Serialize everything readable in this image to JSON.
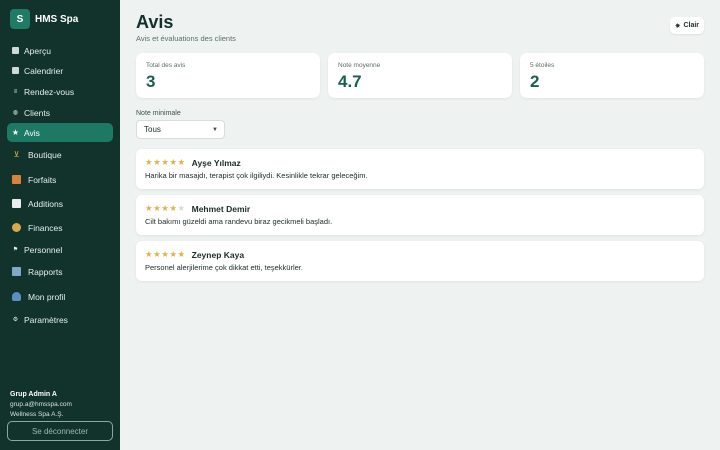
{
  "brand": {
    "logo_letter": "S",
    "name": "HMS Spa"
  },
  "nav": [
    {
      "label": "Aperçu",
      "icon": "overview-icon"
    },
    {
      "label": "Calendrier",
      "icon": "calendar-icon"
    },
    {
      "label": "Rendez-vous",
      "icon": "appointments-icon"
    },
    {
      "label": "Clients",
      "icon": "clients-icon"
    },
    {
      "label": "Avis",
      "icon": "star-icon"
    },
    {
      "label": "Boutique",
      "icon": "cart-icon"
    },
    {
      "label": "Forfaits",
      "icon": "package-icon"
    },
    {
      "label": "Additions",
      "icon": "receipt-icon"
    },
    {
      "label": "Finances",
      "icon": "money-bag-icon"
    },
    {
      "label": "Personnel",
      "icon": "flag-icon"
    },
    {
      "label": "Rapports",
      "icon": "chart-icon"
    },
    {
      "label": "Mon profil",
      "icon": "user-icon"
    },
    {
      "label": "Paramètres",
      "icon": "gear-icon"
    }
  ],
  "active_nav": "Avis",
  "user": {
    "name": "Grup Admin A",
    "email": "grup.a@hmsspa.com",
    "company": "Wellness Spa A.Ş."
  },
  "logout_label": "Se déconnecter",
  "header": {
    "title": "Avis",
    "subtitle": "Avis et évaluations des clients",
    "theme_label": "Clair",
    "theme_icon": "sun-icon"
  },
  "stats": [
    {
      "label": "Total des avis",
      "value": "3"
    },
    {
      "label": "Note moyenne",
      "value": "4.7"
    },
    {
      "label": "5 étoiles",
      "value": "2"
    }
  ],
  "filter": {
    "label": "Note minimale",
    "selected": "Tous"
  },
  "reviews": [
    {
      "author": "Ayşe Yılmaz",
      "rating": 5,
      "text": "Harika bir masajdı, terapist çok ilgiliydi. Kesinlikle tekrar geleceğim."
    },
    {
      "author": "Mehmet Demir",
      "rating": 4,
      "text": "Cilt bakımı güzeldi ama randevu biraz gecikmeli başladı."
    },
    {
      "author": "Zeynep Kaya",
      "rating": 5,
      "text": "Personel alerjilerime çok dikkat etti, teşekkürler."
    }
  ],
  "colors": {
    "sidebar_bg": "#12332c",
    "accent": "#1d7864",
    "stat_value": "#1a5e50",
    "star": "#e2b04a",
    "page_bg": "#eef3f2"
  }
}
